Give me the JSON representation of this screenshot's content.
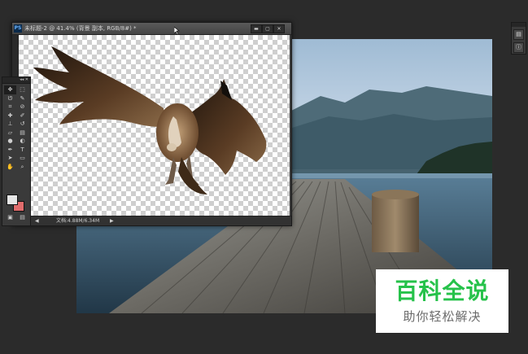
{
  "document_window": {
    "title": "未标题-2 @ 41.4% (背景 副本, RGB/8#) *",
    "logo": "PS",
    "controls": {
      "minimize": "▬",
      "maximize": "▢",
      "close": "✕"
    },
    "canvas_content": "vulture-in-flight-on-transparent",
    "status": {
      "zoom": "",
      "doc_size": "文档:4.88M/6.34M",
      "arrow_left": "◀",
      "arrow_right": "▶"
    }
  },
  "tools_panel": {
    "collapse_label": "◂◂ ✕",
    "tools": [
      {
        "name": "move-tool",
        "glyph": "✥"
      },
      {
        "name": "marquee-tool",
        "glyph": "⬚"
      },
      {
        "name": "lasso-tool",
        "glyph": "ᘎ"
      },
      {
        "name": "quick-select-tool",
        "glyph": "✎"
      },
      {
        "name": "crop-tool",
        "glyph": "⌗"
      },
      {
        "name": "eyedropper-tool",
        "glyph": "⊘"
      },
      {
        "name": "spot-heal-tool",
        "glyph": "✚"
      },
      {
        "name": "brush-tool",
        "glyph": "✐"
      },
      {
        "name": "clone-stamp-tool",
        "glyph": "⊥"
      },
      {
        "name": "history-brush-tool",
        "glyph": "↺"
      },
      {
        "name": "eraser-tool",
        "glyph": "▱"
      },
      {
        "name": "gradient-tool",
        "glyph": "▤"
      },
      {
        "name": "blur-tool",
        "glyph": "●"
      },
      {
        "name": "dodge-tool",
        "glyph": "◐"
      },
      {
        "name": "pen-tool",
        "glyph": "✒"
      },
      {
        "name": "type-tool",
        "glyph": "T"
      },
      {
        "name": "path-select-tool",
        "glyph": "➤"
      },
      {
        "name": "shape-tool",
        "glyph": "▭"
      },
      {
        "name": "hand-tool",
        "glyph": "✋"
      },
      {
        "name": "zoom-tool",
        "glyph": "⌕"
      }
    ],
    "foreground_color": "#e6e6e6",
    "background_color": "#e06c6c",
    "bottom_icons": [
      "▣",
      "▤"
    ]
  },
  "right_dock": {
    "buttons": [
      "▤",
      "ⓘ"
    ]
  },
  "watermark": {
    "title": "百科全说",
    "subtitle": "助你轻松解决"
  },
  "colors": {
    "app_bg": "#2b2b2b",
    "watermark_green": "#26c24a"
  }
}
